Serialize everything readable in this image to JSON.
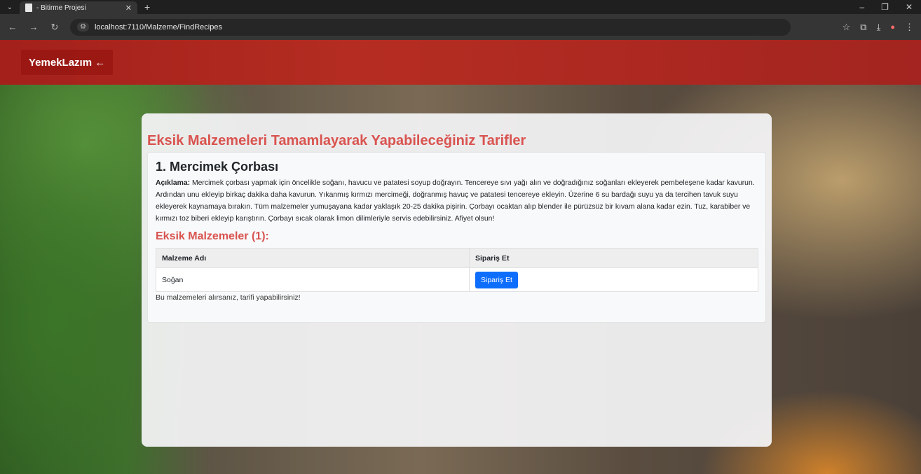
{
  "browser": {
    "tab_title": "- Bitirme Projesi",
    "url": "localhost:7110/Malzeme/FindRecipes"
  },
  "site": {
    "brand": "YemekLazım ←"
  },
  "main": {
    "title": "Eksik Malzemeleri Tamamlayarak Yapabileceğiniz Tarifler",
    "recipe": {
      "title": "1. Mercimek Çorbası",
      "desc_label": "Açıklama:",
      "desc_text": " Mercimek çorbası yapmak için öncelikle soğanı, havucu ve patatesi soyup doğrayın. Tencereye sıvı yağı alın ve doğradığınız soğanları ekleyerek pembeleşene kadar kavurun. Ardından unu ekleyip birkaç dakika daha kavurun. Yıkanmış kırmızı mercimeği, doğranmış havuç ve patatesi tencereye ekleyin. Üzerine 6 su bardağı suyu ya da tercihen tavuk suyu ekleyerek kaynamaya bırakın. Tüm malzemeler yumuşayana kadar yaklaşık 20-25 dakika pişirin. Çorbayı ocaktan alıp blender ile pürüzsüz bir kıvam alana kadar ezin. Tuz, karabiber ve kırmızı toz biberi ekleyip karıştırın. Çorbayı sıcak olarak limon dilimleriyle servis edebilirsiniz. Afiyet olsun!",
      "missing_title": "Eksik Malzemeler (1):",
      "table": {
        "headers": [
          "Malzeme Adı",
          "Sipariş Et"
        ],
        "rows": [
          {
            "name": "Soğan",
            "button": "Sipariş Et"
          }
        ]
      },
      "note": "Bu malzemeleri alırsanız, tarifi yapabilirsiniz!"
    }
  },
  "colors": {
    "accent_red": "#d9534f",
    "header_red": "#a3201b",
    "button_blue": "#0d6efd"
  }
}
